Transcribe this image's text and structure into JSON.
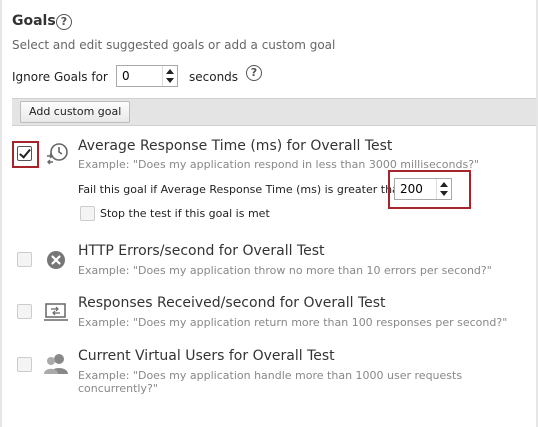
{
  "header": {
    "title": "Goals",
    "subtitle": "Select and edit suggested goals or add a custom goal"
  },
  "ignore": {
    "label": "Ignore Goals for",
    "value": "0",
    "unit": "seconds"
  },
  "toolbar": {
    "add_label": "Add custom goal"
  },
  "goals": [
    {
      "title": "Average Response Time (ms) for Overall Test",
      "example": "Example: \"Does my application respond in less than 3000 milliseconds?\"",
      "checked": true,
      "icon": "response-time-icon",
      "threshold_label": "Fail this goal if Average Response Time (ms) is greater than",
      "threshold_value": "200",
      "stop_label": "Stop the test if this goal is met"
    },
    {
      "title": "HTTP Errors/second for Overall Test",
      "example": "Example: \"Does my application throw no more than 10 errors per second?\"",
      "checked": false,
      "icon": "error-x-icon"
    },
    {
      "title": "Responses Received/second for Overall Test",
      "example": "Example: \"Does my application return more than 100 responses per second?\"",
      "checked": false,
      "icon": "responses-icon"
    },
    {
      "title": "Current Virtual Users for Overall Test",
      "example": "Example: \"Does my application handle more than 1000 user requests concurrently?\"",
      "checked": false,
      "icon": "users-icon"
    }
  ],
  "colors": {
    "highlight": "#a4262c",
    "toolbar": "#e4e4e4"
  }
}
